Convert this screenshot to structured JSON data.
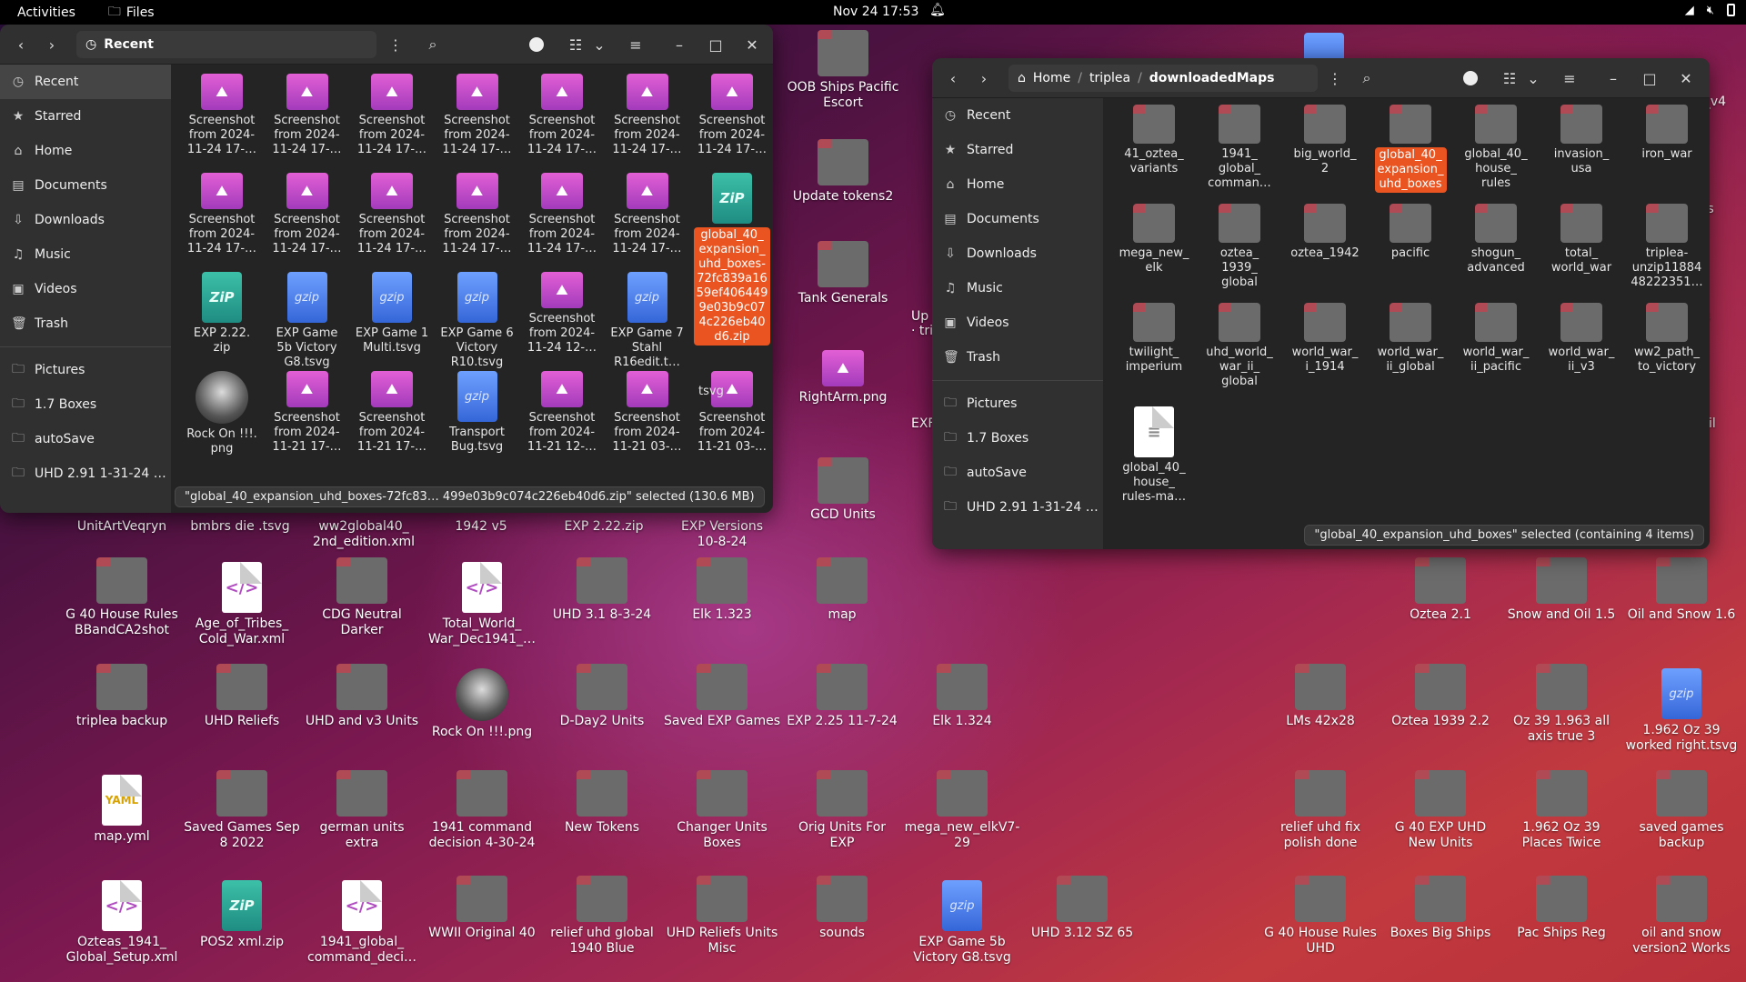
{
  "topbar": {
    "activities": "Activities",
    "app": "Files",
    "clock": "Nov 24  17:53"
  },
  "desktop": {
    "col_top": [
      {
        "label": "OOB Ships Pacific\nEscort",
        "kind": "folder"
      },
      {
        "label": "Update tokens2",
        "kind": "folder"
      },
      {
        "label": "Tank Generals",
        "kind": "folder"
      },
      {
        "label": "RightArm.png",
        "kind": "image"
      },
      {
        "label": "GCD Units",
        "kind": "folder"
      }
    ],
    "partial": [
      "Up",
      "· tri",
      "EXF",
      "i_v4",
      "its",
      "ts",
      "Oil"
    ],
    "row0": [
      "UnitArtVeqryn",
      "bmbrs die .tsvg",
      "ww2global40_\n2nd_edition.xml",
      "1942 v5",
      "EXP 2.22.zip",
      "EXP Versions\n10-8-24"
    ],
    "row1": [
      {
        "label": "G 40 House Rules\nBBandCA2shot",
        "kind": "folder"
      },
      {
        "label": "Age_of_Tribes_\nCold_War.xml",
        "kind": "doc"
      },
      {
        "label": "CDG Neutral\nDarker",
        "kind": "folder"
      },
      {
        "label": "Total_World_\nWar_Dec1941_…",
        "kind": "doc"
      },
      {
        "label": "UHD 3.1 8-3-24",
        "kind": "folder"
      },
      {
        "label": "Elk 1.323",
        "kind": "folder"
      },
      {
        "label": "map",
        "kind": "folder"
      }
    ],
    "row1r": [
      {
        "label": "Oztea 2.1",
        "kind": "folder"
      },
      {
        "label": "Snow and Oil 1.5",
        "kind": "folder"
      },
      {
        "label": "Oil and Snow 1.6",
        "kind": "folder"
      }
    ],
    "row2": [
      {
        "label": "triplea backup",
        "kind": "folder"
      },
      {
        "label": "UHD Reliefs",
        "kind": "folder"
      },
      {
        "label": "UHD and v3 Units",
        "kind": "folder"
      },
      {
        "label": "Rock On !!!.png",
        "kind": "avatar"
      },
      {
        "label": "D-Day2 Units",
        "kind": "folder"
      },
      {
        "label": "Saved EXP Games",
        "kind": "folder"
      },
      {
        "label": "EXP 2.25 11-7-24",
        "kind": "folder"
      },
      {
        "label": "Elk 1.324",
        "kind": "folder"
      }
    ],
    "row2r": [
      {
        "label": "LMs 42x28",
        "kind": "folder"
      },
      {
        "label": "Oztea 1939 2.2",
        "kind": "folder"
      },
      {
        "label": "Oz 39 1.963 all\naxis true 3",
        "kind": "folder"
      },
      {
        "label": "1.962 Oz 39\nworked right.tsvg",
        "kind": "gz"
      }
    ],
    "row3": [
      {
        "label": "map.yml",
        "kind": "yml"
      },
      {
        "label": "Saved Games Sep\n8 2022",
        "kind": "folder"
      },
      {
        "label": "german units\nextra",
        "kind": "folder"
      },
      {
        "label": "1941 command\ndecision 4-30-24",
        "kind": "folder"
      },
      {
        "label": "New Tokens",
        "kind": "folder"
      },
      {
        "label": "Changer Units\nBoxes",
        "kind": "folder"
      },
      {
        "label": "Orig Units For\nEXP",
        "kind": "folder"
      },
      {
        "label": "mega_new_elkV7-\n29",
        "kind": "folder"
      }
    ],
    "row3r": [
      {
        "label": "relief uhd fix\npolish done",
        "kind": "folder"
      },
      {
        "label": "G 40 EXP UHD\nNew Units",
        "kind": "folder"
      },
      {
        "label": "1.962 Oz 39\nPlaces Twice",
        "kind": "folder"
      },
      {
        "label": "saved games\nbackup",
        "kind": "folder"
      }
    ],
    "row4": [
      {
        "label": "Ozteas_1941_\nGlobal_Setup.xml",
        "kind": "doc"
      },
      {
        "label": "POS2 xml.zip",
        "kind": "zip"
      },
      {
        "label": "1941_global_\ncommand_deci…",
        "kind": "doc"
      },
      {
        "label": "WWII Original 40",
        "kind": "folder"
      },
      {
        "label": "relief uhd global\n1940 Blue",
        "kind": "folder"
      },
      {
        "label": "UHD Reliefs Units\nMisc",
        "kind": "folder"
      },
      {
        "label": "sounds",
        "kind": "folder"
      },
      {
        "label": "EXP Game 5b\nVictory G8.tsvg",
        "kind": "gz"
      },
      {
        "label": "UHD 3.12 SZ 65",
        "kind": "folder"
      }
    ],
    "row4r": [
      {
        "label": "G 40 House Rules\nUHD",
        "kind": "folder"
      },
      {
        "label": "Boxes Big Ships",
        "kind": "folder"
      },
      {
        "label": "Pac Ships Reg",
        "kind": "folder"
      },
      {
        "label": "oil and snow\nversion2 Works",
        "kind": "folder"
      }
    ]
  },
  "win1": {
    "title": "Recent",
    "sidebar": [
      "Recent",
      "Starred",
      "Home",
      "Documents",
      "Downloads",
      "Music",
      "Videos",
      "Trash",
      "Pictures",
      "1.7 Boxes",
      "autoSave",
      "UHD 2.91 1-31-24 …"
    ],
    "items": [
      {
        "label": "Screenshot\nfrom 2024-\n11-24 17-…",
        "kind": "image"
      },
      {
        "label": "Screenshot\nfrom 2024-\n11-24 17-…",
        "kind": "image"
      },
      {
        "label": "Screenshot\nfrom 2024-\n11-24 17-…",
        "kind": "image"
      },
      {
        "label": "Screenshot\nfrom 2024-\n11-24 17-…",
        "kind": "image"
      },
      {
        "label": "Screenshot\nfrom 2024-\n11-24 17-…",
        "kind": "image"
      },
      {
        "label": "Screenshot\nfrom 2024-\n11-24 17-…",
        "kind": "image"
      },
      {
        "label": "Screenshot\nfrom 2024-\n11-24 17-…",
        "kind": "image"
      },
      {
        "label": "Screenshot\nfrom 2024-\n11-24 17-…",
        "kind": "image"
      },
      {
        "label": "Screenshot\nfrom 2024-\n11-24 17-…",
        "kind": "image"
      },
      {
        "label": "Screenshot\nfrom 2024-\n11-24 17-…",
        "kind": "image"
      },
      {
        "label": "Screenshot\nfrom 2024-\n11-24 17-…",
        "kind": "image"
      },
      {
        "label": "Screenshot\nfrom 2024-\n11-24 17-…",
        "kind": "image"
      },
      {
        "label": "Screenshot\nfrom 2024-\n11-24 17-…",
        "kind": "image"
      },
      {
        "label": "global_40_\nexpansion_\nuhd_boxes-\n72fc839a16\n59ef406449\n9e03b9c07\n4c226eb40\nd6.zip",
        "kind": "zip",
        "selected": true
      },
      {
        "label": "EXP 2.22.\nzip",
        "kind": "zip"
      },
      {
        "label": "EXP Game\n5b Victory\nG8.tsvg",
        "kind": "gz"
      },
      {
        "label": "EXP Game 1\nMulti.tsvg",
        "kind": "gz"
      },
      {
        "label": "EXP Game 6\nVictory\nR10.tsvg",
        "kind": "gz"
      },
      {
        "label": "Screenshot\nfrom 2024-\n11-24 12-…",
        "kind": "image"
      },
      {
        "label": "EXP Game 7\nStahl\nR16edit.t…",
        "kind": "gz"
      },
      {
        "label": "",
        "kind": "none"
      },
      {
        "label": "Rock On !!!.\npng",
        "kind": "avatar"
      },
      {
        "label": "Screenshot\nfrom 2024-\n11-21 17-…",
        "kind": "image"
      },
      {
        "label": "Screenshot\nfrom 2024-\n11-21 17-…",
        "kind": "image"
      },
      {
        "label": "Transport\nBug.tsvg",
        "kind": "gz"
      },
      {
        "label": "Screenshot\nfrom 2024-\n11-21 12-…",
        "kind": "image"
      },
      {
        "label": "Screenshot\nfrom 2024-\n11-21 03-…",
        "kind": "image"
      },
      {
        "label": "Screenshot\nfrom 2024-\n11-21 03-…",
        "kind": "image"
      }
    ],
    "tsvg_tail": "tsvg",
    "status": "\"global_40_expansion_uhd_boxes-72fc83… 499e03b9c074c226eb40d6.zip\" selected  (130.6 MB)"
  },
  "win2": {
    "path": [
      "Home",
      "triplea",
      "downloadedMaps"
    ],
    "sidebar": [
      "Recent",
      "Starred",
      "Home",
      "Documents",
      "Downloads",
      "Music",
      "Videos",
      "Trash",
      "Pictures",
      "1.7 Boxes",
      "autoSave",
      "UHD 2.91 1-31-24 …"
    ],
    "items": [
      {
        "label": "41_oztea_\nvariants",
        "kind": "folder"
      },
      {
        "label": "1941_\nglobal_\ncomman…",
        "kind": "folder"
      },
      {
        "label": "big_world_\n2",
        "kind": "folder"
      },
      {
        "label": "global_40_\nexpansion_\nuhd_boxes",
        "kind": "folder",
        "selected": true
      },
      {
        "label": "global_40_\nhouse_\nrules",
        "kind": "folder"
      },
      {
        "label": "invasion_\nusa",
        "kind": "folder"
      },
      {
        "label": "iron_war",
        "kind": "folder"
      },
      {
        "label": "mega_new_\nelk",
        "kind": "folder"
      },
      {
        "label": "oztea_\n1939_\nglobal",
        "kind": "folder"
      },
      {
        "label": "oztea_1942",
        "kind": "folder"
      },
      {
        "label": "pacific",
        "kind": "folder"
      },
      {
        "label": "shogun_\nadvanced",
        "kind": "folder"
      },
      {
        "label": "total_\nworld_war",
        "kind": "folder"
      },
      {
        "label": "triplea-\nunzip11884\n48222351…",
        "kind": "folder"
      },
      {
        "label": "twilight_\nimperium",
        "kind": "folder"
      },
      {
        "label": "uhd_world_\nwar_ii_\nglobal",
        "kind": "folder"
      },
      {
        "label": "world_war_\ni_1914",
        "kind": "folder"
      },
      {
        "label": "world_war_\nii_global",
        "kind": "folder"
      },
      {
        "label": "world_war_\nii_pacific",
        "kind": "folder"
      },
      {
        "label": "world_war_\nii_v3",
        "kind": "folder"
      },
      {
        "label": "ww2_path_\nto_victory",
        "kind": "folder"
      },
      {
        "label": "global_40_\nhouse_\nrules-ma…",
        "kind": "text"
      }
    ],
    "status": "\"global_40_expansion_uhd_boxes\" selected (containing 4 items)"
  }
}
